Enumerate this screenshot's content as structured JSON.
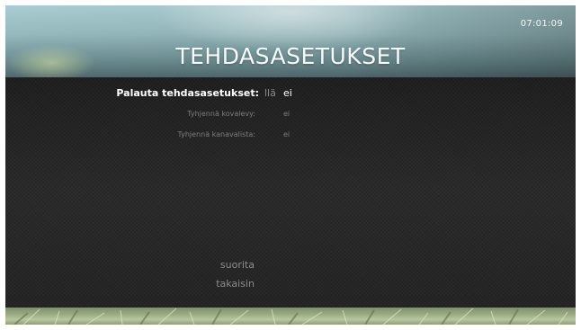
{
  "header": {
    "clock": "07:01:09",
    "title": "TEHDASASETUKSET"
  },
  "settings": {
    "reset": {
      "label": "Palauta tehdasasetukset:",
      "option_yes": "llä",
      "option_no": "ei"
    },
    "clear_hdd": {
      "label": "Tyhjennä kovalevy:",
      "value": "ei"
    },
    "clear_channels": {
      "label": "Tyhjennä kanavalista:",
      "value": "ei"
    }
  },
  "actions": {
    "run": "suorita",
    "back": "takaisin"
  },
  "colors": {
    "background": "#262626",
    "header_sky": "#95b9bd",
    "selected_text": "#ffffff",
    "dim_text": "#7d7d7d",
    "footer_grass": "#9aab82"
  }
}
